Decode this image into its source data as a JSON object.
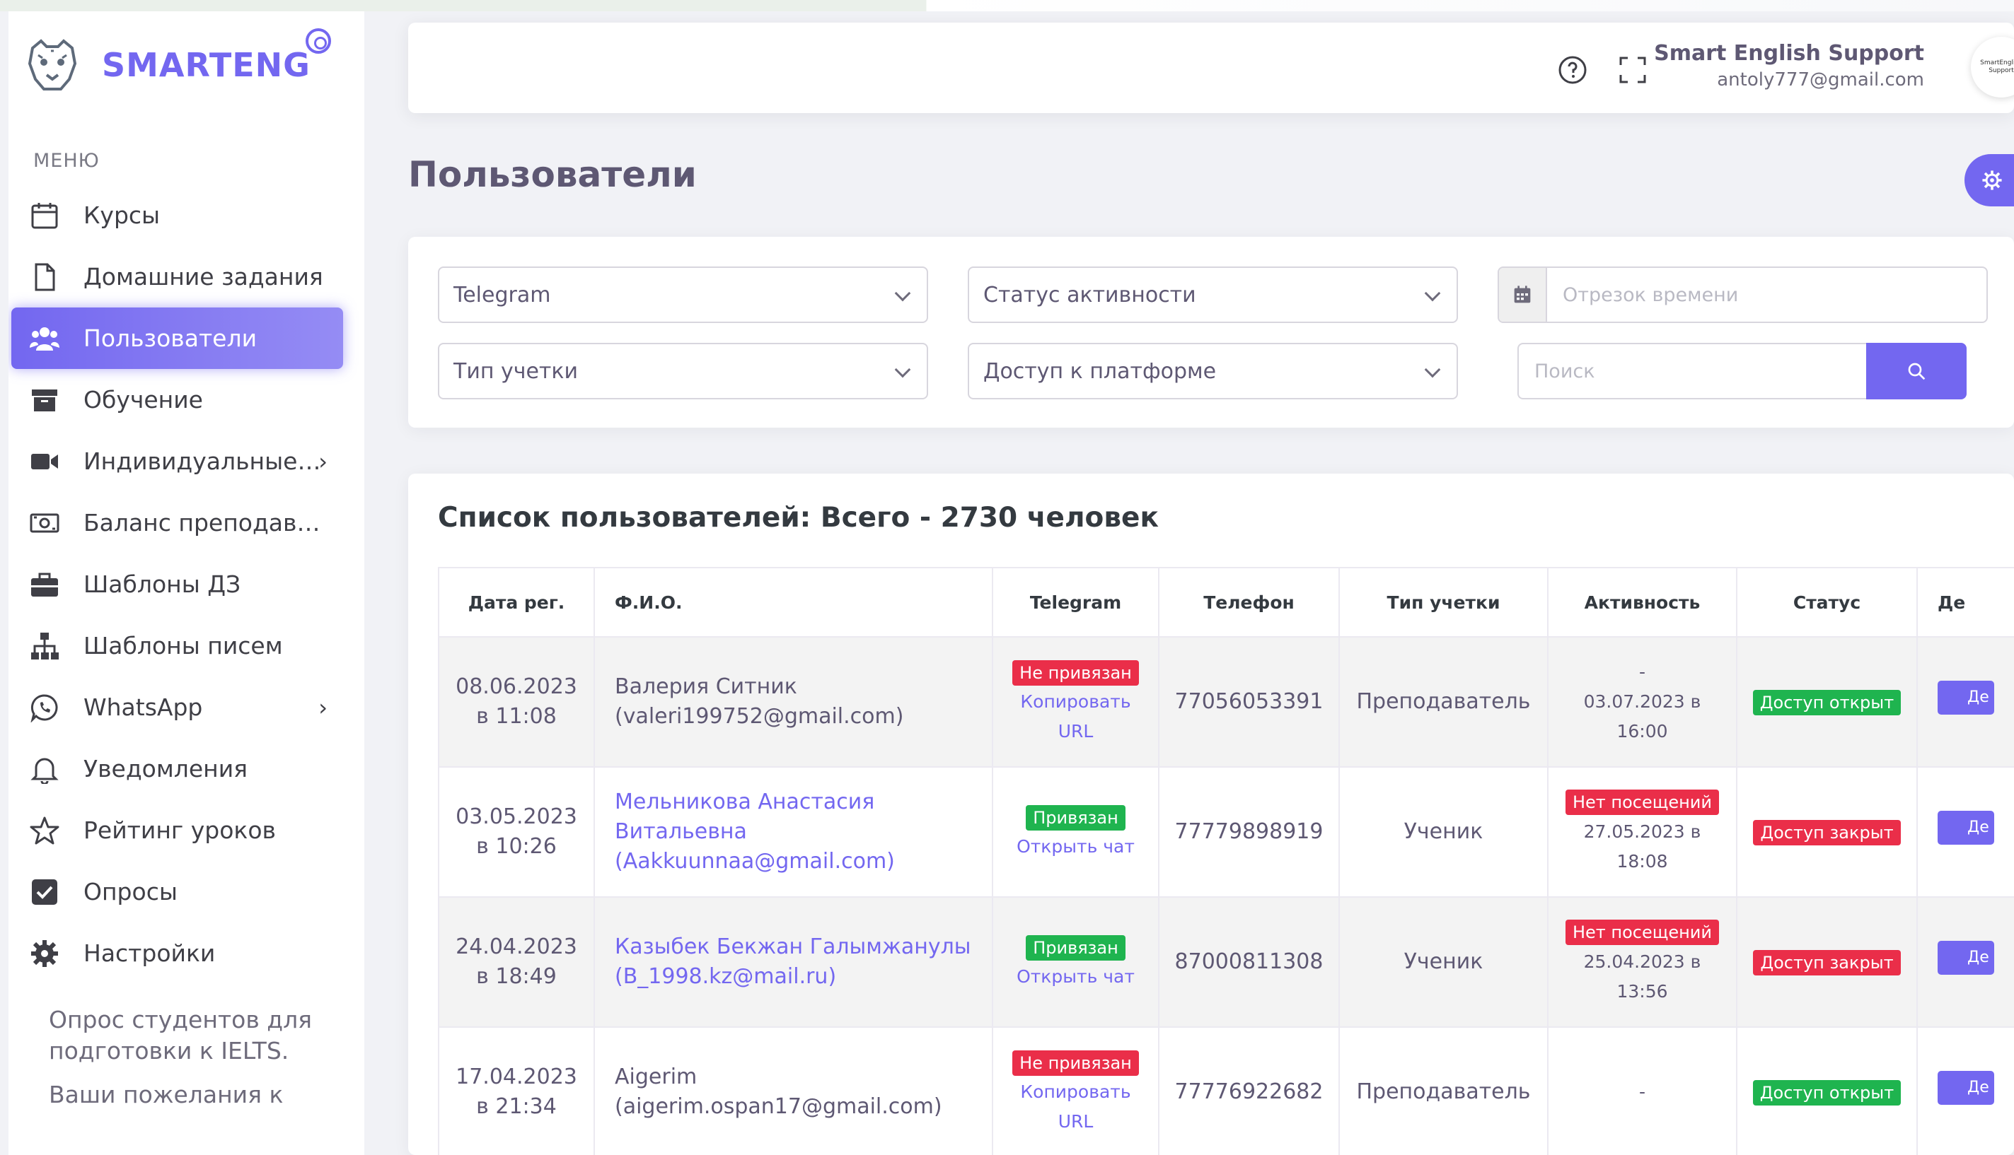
{
  "brand": {
    "name": "SMARTENG"
  },
  "sidebar": {
    "menu_header": "МЕНЮ",
    "items": [
      {
        "label": "Курсы",
        "icon": "calendar-icon"
      },
      {
        "label": "Домашние задания",
        "icon": "file-icon"
      },
      {
        "label": "Пользователи",
        "icon": "users-icon",
        "active": true
      },
      {
        "label": "Обучение",
        "icon": "archive-icon"
      },
      {
        "label": "Индивидуальные ...",
        "icon": "video-icon",
        "has_children": true
      },
      {
        "label": "Баланс преподава...",
        "icon": "money-icon"
      },
      {
        "label": "Шаблоны ДЗ",
        "icon": "briefcase-icon"
      },
      {
        "label": "Шаблоны писем",
        "icon": "sitemap-icon"
      },
      {
        "label": "WhatsApp",
        "icon": "whatsapp-icon",
        "has_children": true
      },
      {
        "label": "Уведомления",
        "icon": "bell-icon"
      },
      {
        "label": "Рейтинг уроков",
        "icon": "star-icon"
      },
      {
        "label": "Опросы",
        "icon": "checkbox-icon"
      },
      {
        "label": "Настройки",
        "icon": "gear-icon"
      }
    ],
    "notes": [
      "Опрос студентов для подготовки к IELTS.",
      "Ваши пожелания к"
    ]
  },
  "header": {
    "user_name": "Smart English Support",
    "user_email": "antoly777@gmail.com",
    "avatar_text": "SmartEnglish Support"
  },
  "page": {
    "title": "Пользователи"
  },
  "filters": {
    "telegram": "Telegram",
    "activity_status": "Статус активности",
    "date_range_placeholder": "Отрезок времени",
    "account_type": "Тип учетки",
    "platform_access": "Доступ к платформе",
    "search_placeholder": "Поиск"
  },
  "users": {
    "title": "Список пользователей: Всего - 2730 человек",
    "columns": [
      "Дата рег.",
      "Ф.И.О.",
      "Telegram",
      "Телефон",
      "Тип учетки",
      "Активность",
      "Статус",
      "Де"
    ],
    "rows": [
      {
        "date": "08.06.2023",
        "time": "в 11:08",
        "name": "Валерия Ситник",
        "email": "(valeri199752@gmail.com)",
        "name_link": false,
        "tg_badge": "Не привязан",
        "tg_badge_color": "red",
        "tg_link1": "Копировать",
        "tg_link2": "URL",
        "phone": "77056053391",
        "type": "Преподаватель",
        "act_badge": "",
        "act_line1": "-",
        "act_line2": "03.07.2023 в",
        "act_line3": "16:00",
        "status": "Доступ открыт",
        "status_color": "green",
        "action": "Де"
      },
      {
        "date": "03.05.2023",
        "time": "в 10:26",
        "name": "Мельникова Анастасия",
        "name2": "Витальевна",
        "email": "(Aakkuunnaa@gmail.com)",
        "name_link": true,
        "tg_badge": "Привязан",
        "tg_badge_color": "green",
        "tg_link1": "Открыть чат",
        "tg_link2": "",
        "phone": "77779898919",
        "type": "Ученик",
        "act_badge": "Нет посещений",
        "act_line1": "",
        "act_line2": "27.05.2023 в",
        "act_line3": "18:08",
        "status": "Доступ закрыт",
        "status_color": "red",
        "action": "Де"
      },
      {
        "date": "24.04.2023",
        "time": "в 18:49",
        "name": "Казыбек Бекжан Галымжанулы",
        "email": "(B_1998.kz@mail.ru)",
        "name_link": true,
        "tg_badge": "Привязан",
        "tg_badge_color": "green",
        "tg_link1": "Открыть чат",
        "tg_link2": "",
        "phone": "87000811308",
        "type": "Ученик",
        "act_badge": "Нет посещений",
        "act_line1": "",
        "act_line2": "25.04.2023 в",
        "act_line3": "13:56",
        "status": "Доступ закрыт",
        "status_color": "red",
        "action": "Де"
      },
      {
        "date": "17.04.2023",
        "time": "в 21:34",
        "name": "Aigerim",
        "email": "(aigerim.ospan17@gmail.com)",
        "name_link": false,
        "tg_badge": "Не привязан",
        "tg_badge_color": "red",
        "tg_link1": "Копировать",
        "tg_link2": "URL",
        "phone": "77776922682",
        "type": "Преподаватель",
        "act_badge": "",
        "act_line1": "-",
        "act_line2": "",
        "act_line3": "",
        "status": "Доступ открыт",
        "status_color": "green",
        "action": "Де"
      }
    ]
  },
  "colors": {
    "accent": "#7367f0",
    "danger": "#ea2e49",
    "success": "#1fb44f"
  }
}
